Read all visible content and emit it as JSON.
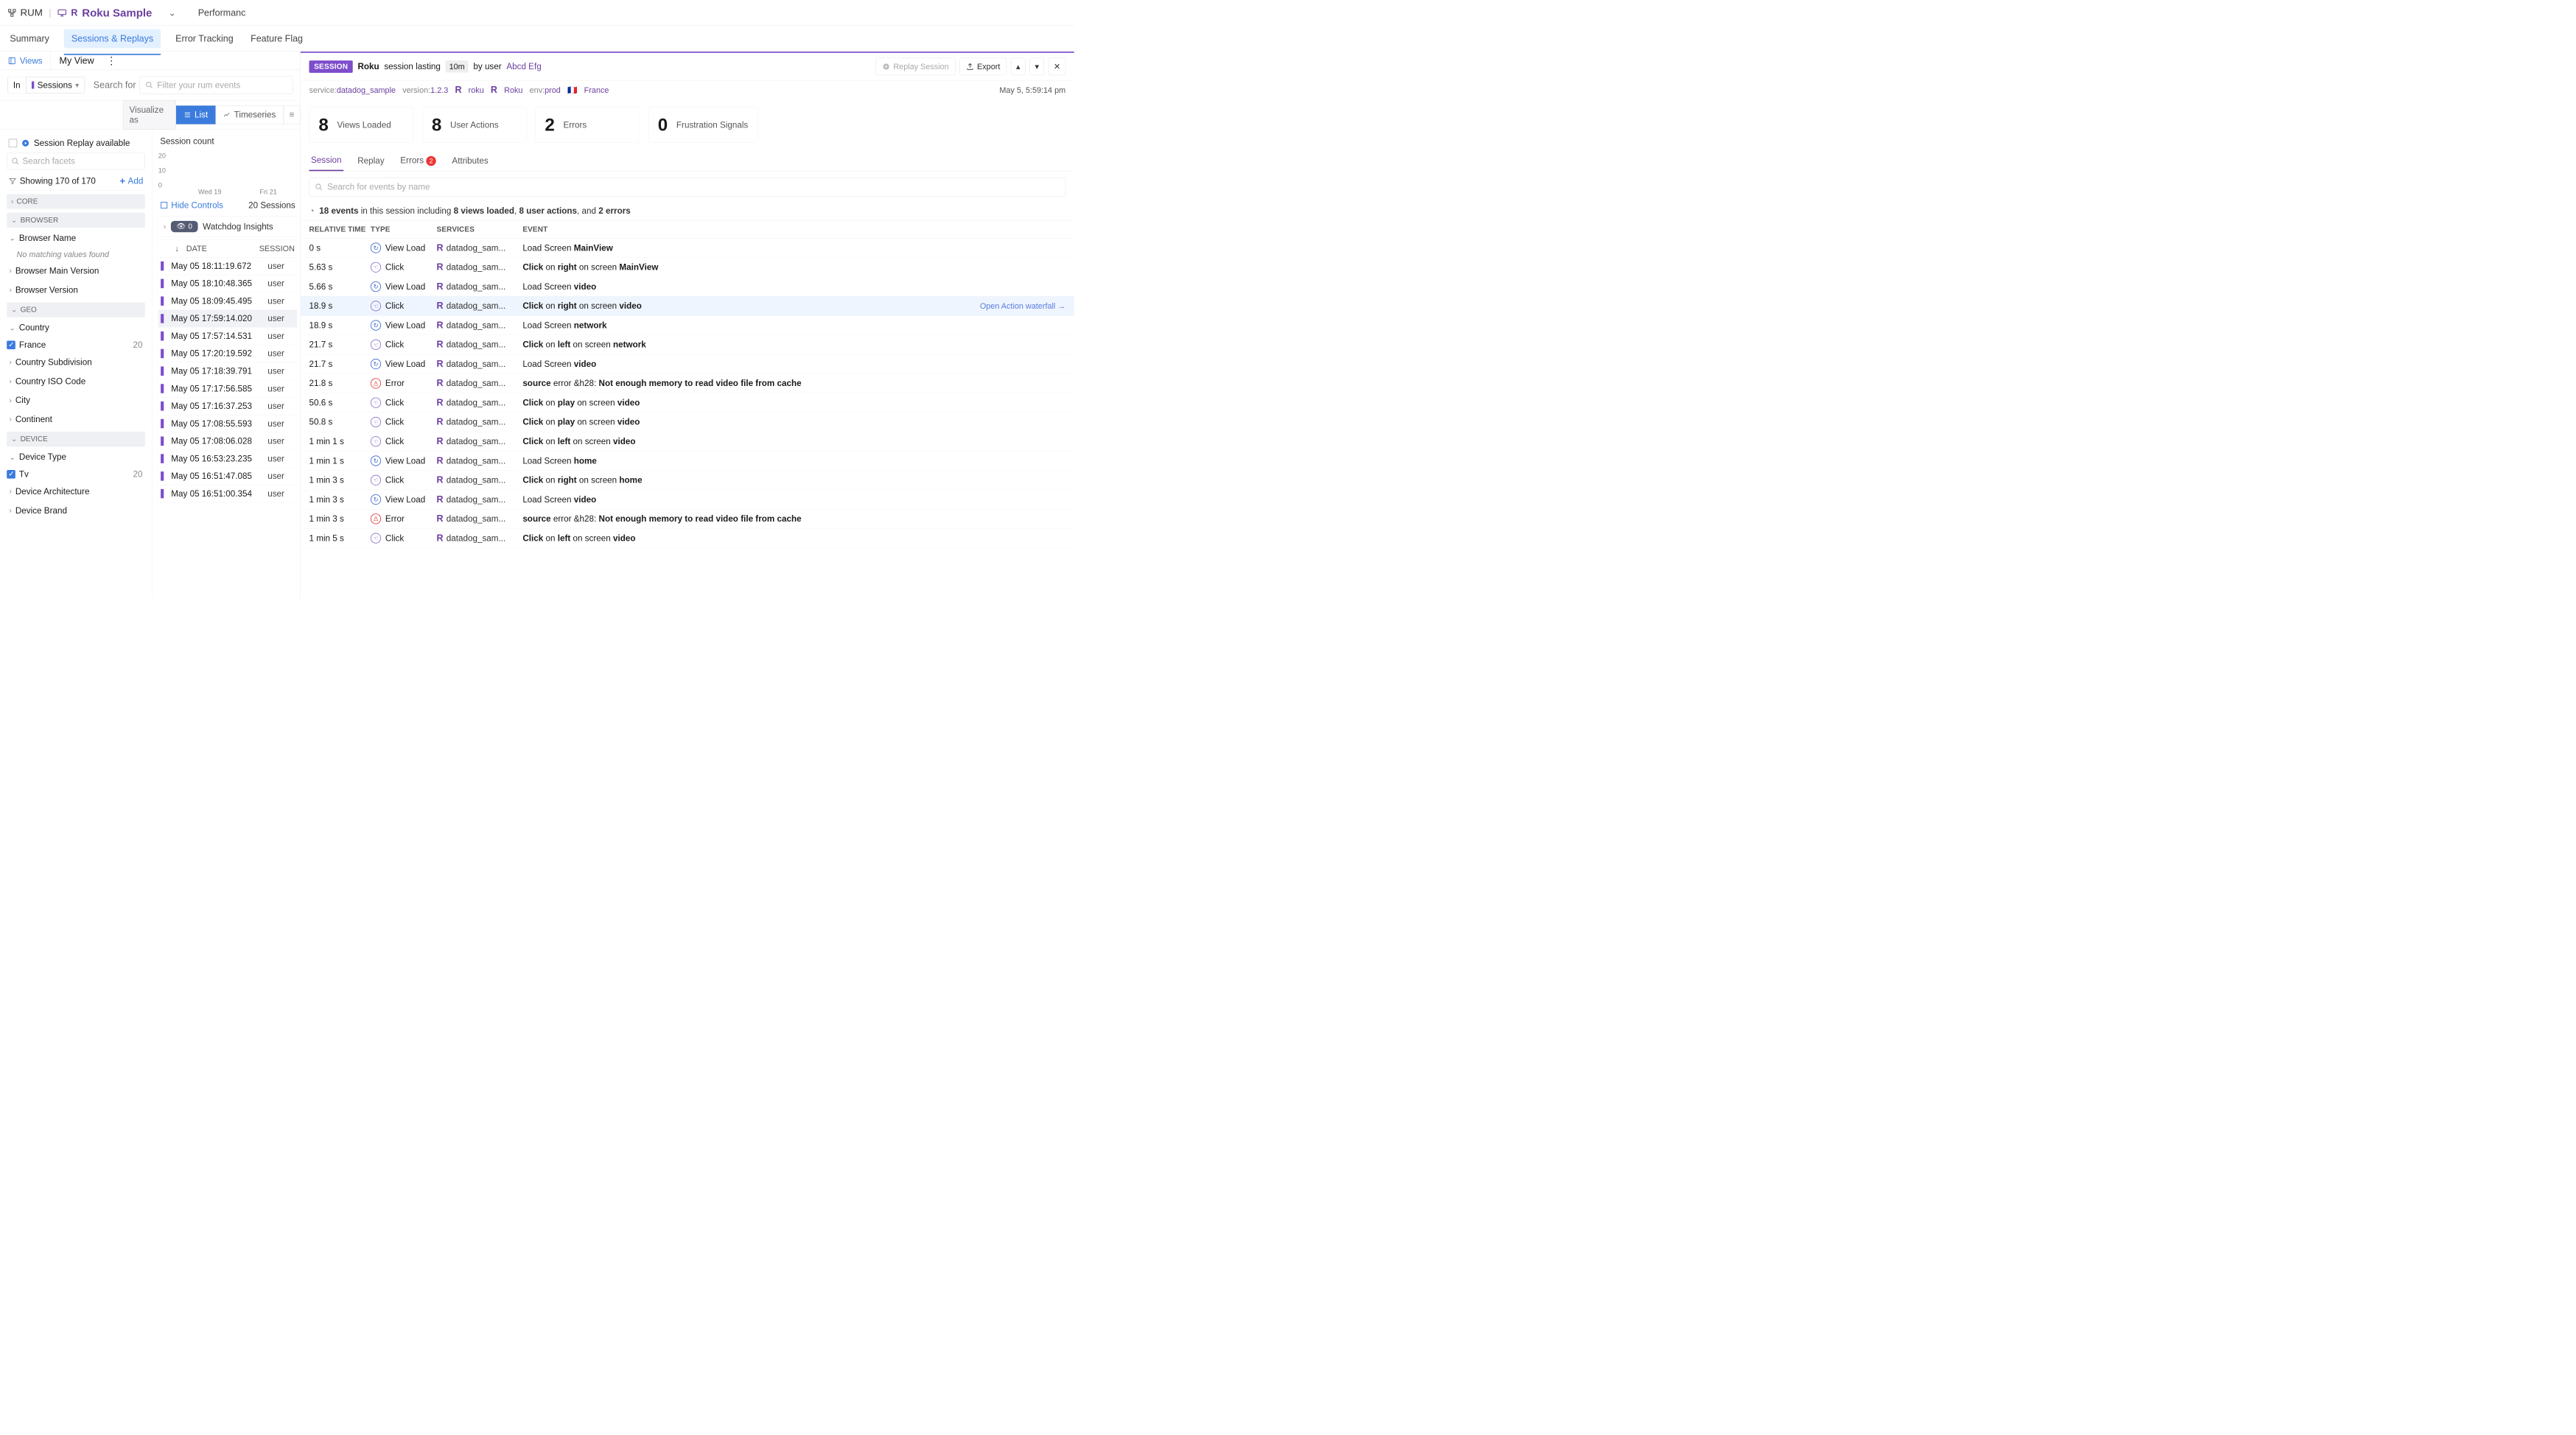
{
  "topbar": {
    "rum_label": "RUM",
    "app_name": "Roku Sample",
    "perf_tab": "Performanc"
  },
  "tabs": {
    "summary": "Summary",
    "sessions": "Sessions & Replays",
    "errors": "Error Tracking",
    "flags": "Feature Flag"
  },
  "views_bar": {
    "views": "Views",
    "my_view": "My View"
  },
  "filter": {
    "in": "In",
    "sessions": "Sessions",
    "search_for": "Search for",
    "placeholder": "Filter your rum events"
  },
  "viz": {
    "label": "Visualize as",
    "list": "List",
    "timeseries": "Timeseries"
  },
  "facets": {
    "replay_avail": "Session Replay available",
    "search_ph": "Search facets",
    "showing": "Showing 170 of 170",
    "add": "Add",
    "grp_core": "CORE",
    "grp_browser": "BROWSER",
    "browser_name": "Browser Name",
    "no_match": "No matching values found",
    "browser_main": "Browser Main Version",
    "browser_ver": "Browser Version",
    "grp_geo": "GEO",
    "country": "Country",
    "france": "France",
    "france_n": "20",
    "subdiv": "Country Subdivision",
    "iso": "Country ISO Code",
    "city": "City",
    "continent": "Continent",
    "grp_device": "DEVICE",
    "dev_type": "Device Type",
    "tv": "Tv",
    "tv_n": "20",
    "dev_arch": "Device Architecture",
    "dev_brand": "Device Brand"
  },
  "sessions": {
    "count_label": "Session count",
    "y20": "20",
    "y10": "10",
    "y0": "0",
    "x1": "Wed 19",
    "x2": "Fri 21",
    "hide": "Hide Controls",
    "n_sessions": "20 Sessions",
    "watchdog_n": "0",
    "watchdog": "Watchdog Insights",
    "col_date": "DATE",
    "col_sid": "SESSION",
    "rows": [
      {
        "date": "May 05 18:11:19.672",
        "sid": "user"
      },
      {
        "date": "May 05 18:10:48.365",
        "sid": "user"
      },
      {
        "date": "May 05 18:09:45.495",
        "sid": "user"
      },
      {
        "date": "May 05 17:59:14.020",
        "sid": "user",
        "sel": true
      },
      {
        "date": "May 05 17:57:14.531",
        "sid": "user"
      },
      {
        "date": "May 05 17:20:19.592",
        "sid": "user"
      },
      {
        "date": "May 05 17:18:39.791",
        "sid": "user"
      },
      {
        "date": "May 05 17:17:56.585",
        "sid": "user"
      },
      {
        "date": "May 05 17:16:37.253",
        "sid": "user"
      },
      {
        "date": "May 05 17:08:55.593",
        "sid": "user"
      },
      {
        "date": "May 05 17:08:06.028",
        "sid": "user"
      },
      {
        "date": "May 05 16:53:23.235",
        "sid": "user"
      },
      {
        "date": "May 05 16:51:47.085",
        "sid": "user"
      },
      {
        "date": "May 05 16:51:00.354",
        "sid": "user"
      }
    ]
  },
  "detail": {
    "badge": "SESSION",
    "app": "Roku",
    "lasting": "session lasting",
    "dur": "10m",
    "by": "by user",
    "user": "Abcd Efg",
    "replay": "Replay Session",
    "export": "Export",
    "timestamp": "May 5, 5:59:14 pm",
    "tags": {
      "svc_k": "service:",
      "svc_v": "datadog_sample",
      "ver_k": "version:",
      "ver_v": "1.2.3",
      "roku1": "roku",
      "roku2": "Roku",
      "env_k": "env:",
      "env_v": "prod",
      "country": "France"
    },
    "metrics": [
      {
        "n": "8",
        "l": "Views Loaded"
      },
      {
        "n": "8",
        "l": "User Actions"
      },
      {
        "n": "2",
        "l": "Errors"
      },
      {
        "n": "0",
        "l": "Frustration Signals"
      }
    ],
    "dtabs": {
      "session": "Session",
      "replay": "Replay",
      "errors": "Errors",
      "err_n": "2",
      "attrs": "Attributes"
    },
    "search_ph": "Search for events by name",
    "summary_pre": "18 events",
    "summary_mid": " in this session including ",
    "summary_views": "8 views loaded",
    "summary_actions": "8 user actions",
    "summary_and": ", and ",
    "summary_errs": "2 errors",
    "cols": {
      "time": "RELATIVE TIME",
      "type": "TYPE",
      "svc": "SERVICES",
      "event": "EVENT"
    },
    "svc": "datadog_sam...",
    "waterfall": "Open Action waterfall",
    "events": [
      {
        "t": "0 s",
        "ty": "View Load",
        "k": "view",
        "e": [
          "Load Screen ",
          "MainView"
        ]
      },
      {
        "t": "5.63 s",
        "ty": "Click",
        "k": "click",
        "e": [
          "Click",
          " on ",
          "right",
          " on screen ",
          "MainView"
        ]
      },
      {
        "t": "5.66 s",
        "ty": "View Load",
        "k": "view",
        "e": [
          "Load Screen ",
          "video"
        ]
      },
      {
        "t": "18.9 s",
        "ty": "Click",
        "k": "click",
        "hl": true,
        "wf": true,
        "e": [
          "Click",
          " on ",
          "right",
          " on screen ",
          "video"
        ]
      },
      {
        "t": "18.9 s",
        "ty": "View Load",
        "k": "view",
        "e": [
          "Load Screen ",
          "network"
        ]
      },
      {
        "t": "21.7 s",
        "ty": "Click",
        "k": "click",
        "e": [
          "Click",
          " on ",
          "left",
          " on screen ",
          "network"
        ]
      },
      {
        "t": "21.7 s",
        "ty": "View Load",
        "k": "view",
        "e": [
          "Load Screen ",
          "video"
        ]
      },
      {
        "t": "21.8 s",
        "ty": "Error",
        "k": "error",
        "e": [
          "source",
          " error &h28: ",
          "Not enough memory to read video file from cache"
        ]
      },
      {
        "t": "50.6 s",
        "ty": "Click",
        "k": "click",
        "e": [
          "Click",
          " on ",
          "play",
          " on screen ",
          "video"
        ]
      },
      {
        "t": "50.8 s",
        "ty": "Click",
        "k": "click",
        "e": [
          "Click",
          " on ",
          "play",
          " on screen ",
          "video"
        ]
      },
      {
        "t": "1 min 1 s",
        "ty": "Click",
        "k": "click",
        "e": [
          "Click",
          " on ",
          "left",
          " on screen ",
          "video"
        ]
      },
      {
        "t": "1 min 1 s",
        "ty": "View Load",
        "k": "view",
        "e": [
          "Load Screen ",
          "home"
        ]
      },
      {
        "t": "1 min 3 s",
        "ty": "Click",
        "k": "click",
        "e": [
          "Click",
          " on ",
          "right",
          " on screen ",
          "home"
        ]
      },
      {
        "t": "1 min 3 s",
        "ty": "View Load",
        "k": "view",
        "e": [
          "Load Screen ",
          "video"
        ]
      },
      {
        "t": "1 min 3 s",
        "ty": "Error",
        "k": "error",
        "e": [
          "source",
          " error &h28: ",
          "Not enough memory to read video file from cache"
        ]
      },
      {
        "t": "1 min 5 s",
        "ty": "Click",
        "k": "click",
        "e": [
          "Click",
          " on ",
          "left",
          " on screen ",
          "video"
        ]
      }
    ]
  }
}
